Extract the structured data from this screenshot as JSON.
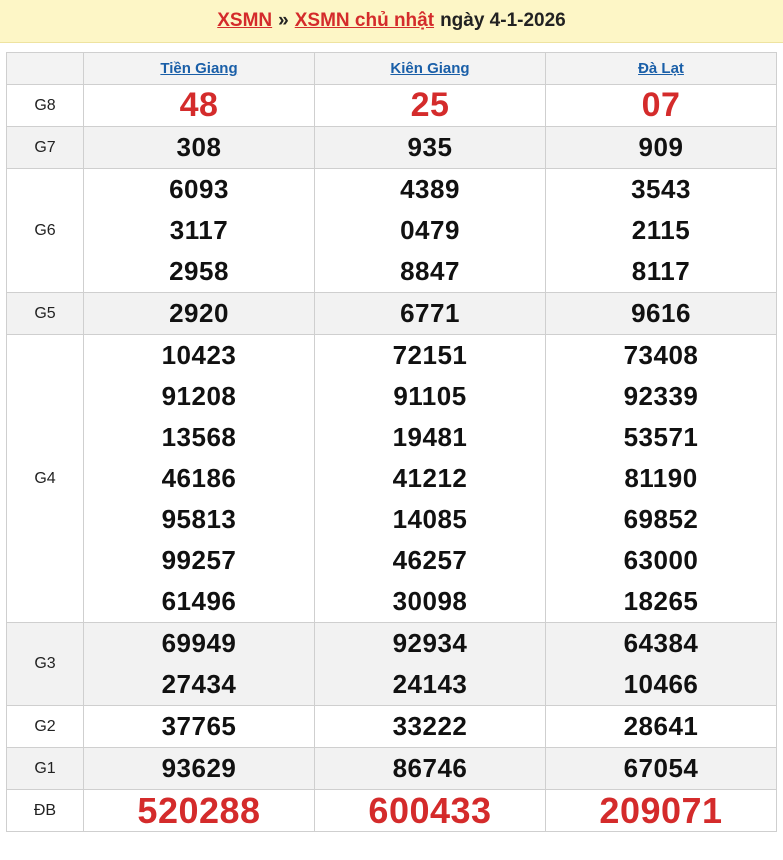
{
  "header": {
    "link1": "XSMN",
    "separator": "»",
    "link2": "XSMN chủ nhật",
    "date_text": "ngày 4-1-2026"
  },
  "colors": {
    "accent_red": "#d42b2b",
    "link_blue": "#1a5fa8",
    "header_bg": "#fdf6c6"
  },
  "provinces": [
    "Tiền Giang",
    "Kiên Giang",
    "Đà Lạt"
  ],
  "prizes": {
    "g8": {
      "label": "G8",
      "values": [
        [
          "48"
        ],
        [
          "25"
        ],
        [
          "07"
        ]
      ]
    },
    "g7": {
      "label": "G7",
      "values": [
        [
          "308"
        ],
        [
          "935"
        ],
        [
          "909"
        ]
      ]
    },
    "g6": {
      "label": "G6",
      "values": [
        [
          "6093",
          "3117",
          "2958"
        ],
        [
          "4389",
          "0479",
          "8847"
        ],
        [
          "3543",
          "2115",
          "8117"
        ]
      ]
    },
    "g5": {
      "label": "G5",
      "values": [
        [
          "2920"
        ],
        [
          "6771"
        ],
        [
          "9616"
        ]
      ]
    },
    "g4": {
      "label": "G4",
      "values": [
        [
          "10423",
          "91208",
          "13568",
          "46186",
          "95813",
          "99257",
          "61496"
        ],
        [
          "72151",
          "91105",
          "19481",
          "41212",
          "14085",
          "46257",
          "30098"
        ],
        [
          "73408",
          "92339",
          "53571",
          "81190",
          "69852",
          "63000",
          "18265"
        ]
      ]
    },
    "g3": {
      "label": "G3",
      "values": [
        [
          "69949",
          "27434"
        ],
        [
          "92934",
          "24143"
        ],
        [
          "64384",
          "10466"
        ]
      ]
    },
    "g2": {
      "label": "G2",
      "values": [
        [
          "37765"
        ],
        [
          "33222"
        ],
        [
          "28641"
        ]
      ]
    },
    "g1": {
      "label": "G1",
      "values": [
        [
          "93629"
        ],
        [
          "86746"
        ],
        [
          "67054"
        ]
      ]
    },
    "db": {
      "label": "ĐB",
      "values": [
        [
          "520288"
        ],
        [
          "600433"
        ],
        [
          "209071"
        ]
      ]
    }
  }
}
